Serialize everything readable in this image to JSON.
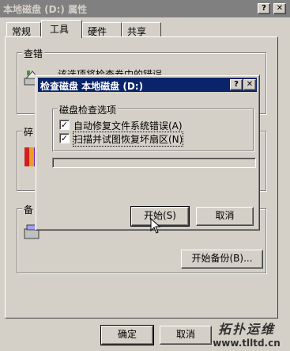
{
  "window": {
    "title": "本地磁盘 (D:) 属性"
  },
  "tabs": [
    {
      "label": "常规"
    },
    {
      "label": "工具"
    },
    {
      "label": "硬件"
    },
    {
      "label": "共享"
    }
  ],
  "sections": {
    "check_legend": "查错",
    "check_desc": "该选项将检查卷中的错误。",
    "defrag_legend_partial": "碎",
    "backup_legend_partial": "备",
    "backup_button": "开始备份(B)..."
  },
  "footer": {
    "ok": "确定",
    "cancel": "取消"
  },
  "dialog": {
    "title": "检查磁盘 本地磁盘 (D:)",
    "group_label": "磁盘检查选项",
    "option1": "自动修复文件系统错误(A)",
    "option1_check": "✓",
    "option2": "扫描并试图恢复坏扇区(N)",
    "option2_check": "✓",
    "start_button": "开始(S)",
    "cancel_button": "取消"
  },
  "title_buttons": {
    "help": "?",
    "close": "✕"
  },
  "watermark": {
    "brand": "拓扑运维",
    "url": "www.tlltd.cn"
  }
}
